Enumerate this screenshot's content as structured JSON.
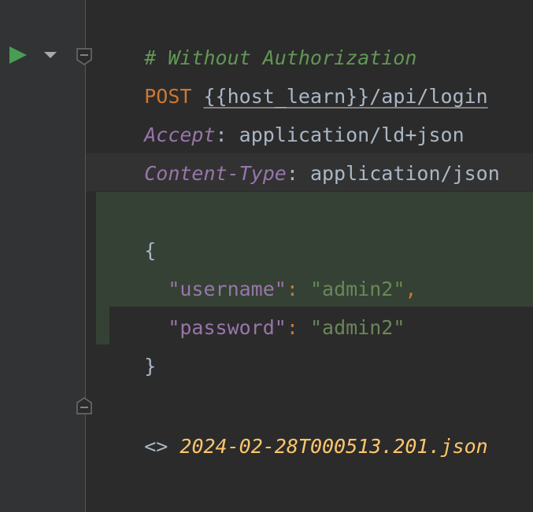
{
  "editor": {
    "lines": {
      "comment": "# Without Authorization",
      "method": "POST",
      "space": " ",
      "url": "{{host_learn}}/api/login",
      "accept_name": "Accept",
      "accept_colon": ":",
      "accept_value": " application/ld+json",
      "ctype_name": "Content-Type",
      "ctype_colon": ":",
      "ctype_value": " application/json",
      "brace_open": "{",
      "brace_close": "}",
      "username_key": "\"username\"",
      "username_value": "\"admin2\"",
      "password_key": "\"password\"",
      "password_value": "\"admin2\"",
      "json_colon": ":",
      "json_comma": ",",
      "indent": "  ",
      "response_marker": "<>",
      "response_file": "2024-02-28T000513.201.json",
      "separator": "###"
    }
  },
  "icons": {
    "run": "run-request-icon",
    "dropdown": "chevron-down-icon",
    "fold": "fold-icon"
  },
  "colors": {
    "background": "#2b2b2b",
    "comment": "#629755",
    "method": "#cc7832",
    "header_name": "#9876aa",
    "json_string": "#6a8759",
    "response_file": "#ffc66d",
    "run_icon": "#499c54"
  }
}
